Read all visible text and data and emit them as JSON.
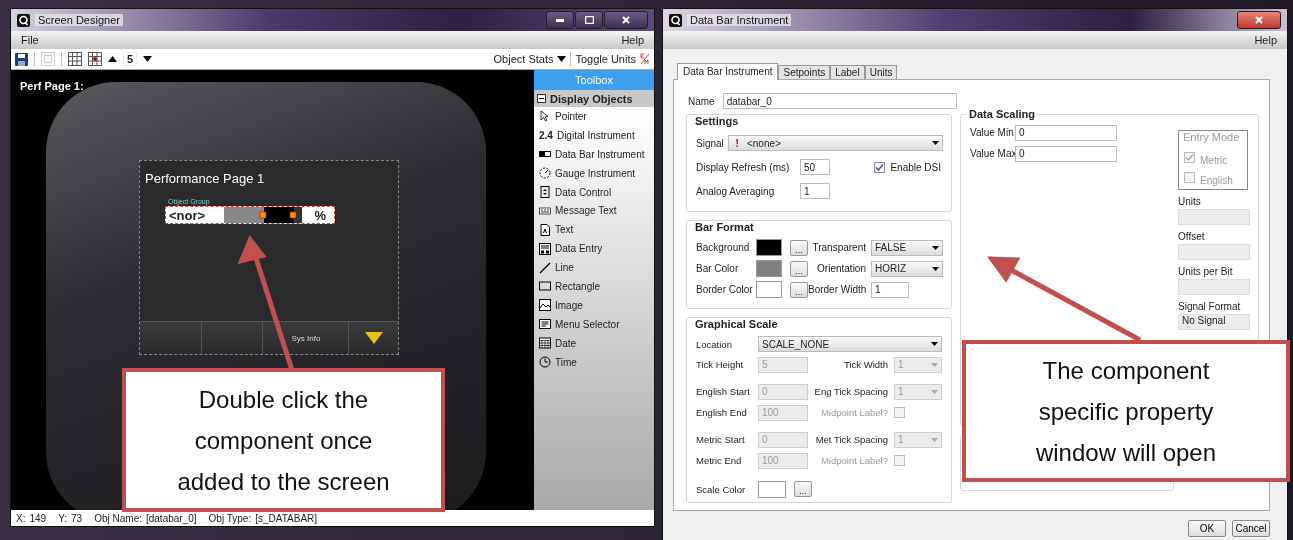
{
  "left_window": {
    "title": "Screen Designer",
    "menu": [
      "File",
      "Help"
    ],
    "toolbar": {
      "page_number": "5",
      "object_stats": "Object Stats",
      "toggle_units": "Toggle Units"
    },
    "canvas": {
      "page_label": "Perf Page 1:",
      "screen": {
        "title": "Performance Page 1",
        "group_label": "Object Group",
        "widget_value": "<nor>",
        "widget_unit": "%",
        "softkey_label": "Sys Info"
      }
    },
    "toolbox": {
      "title": "Toolbox",
      "section": {
        "label": "Display Objects",
        "expanded": true,
        "items": [
          {
            "label": "Pointer"
          },
          {
            "label": "Digital Instrument",
            "icon_text": "2.4"
          },
          {
            "label": "Data Bar Instrument"
          },
          {
            "label": "Gauge Instrument"
          },
          {
            "label": "Data Control"
          },
          {
            "label": "Message Text"
          },
          {
            "label": "Text"
          },
          {
            "label": "Data Entry"
          },
          {
            "label": "Line"
          },
          {
            "label": "Rectangle"
          },
          {
            "label": "Image"
          },
          {
            "label": "Menu Selector"
          },
          {
            "label": "Date"
          },
          {
            "label": "Time"
          }
        ]
      }
    },
    "status_bar": [
      {
        "label": "X:",
        "value": "149"
      },
      {
        "label": "Y:",
        "value": "73"
      },
      {
        "label": "Obj Name:",
        "value": "[databar_0]"
      },
      {
        "label": "Obj Type:",
        "value": "[s_DATABAR]"
      }
    ]
  },
  "right_window": {
    "title": "Data Bar Instrument",
    "menu": [
      "Help"
    ],
    "tabs": [
      {
        "label": "Data Bar Instrument",
        "selected": true
      },
      {
        "label": "Setpoints",
        "selected": false
      },
      {
        "label": "Label",
        "selected": false
      },
      {
        "label": "Units",
        "selected": false
      }
    ],
    "name": {
      "label": "Name",
      "value": "databar_0"
    },
    "settings": {
      "title": "Settings",
      "signal": {
        "label": "Signal",
        "flag": "!",
        "value": "<none>"
      },
      "refresh": {
        "label": "Display Refresh (ms)",
        "value": "50"
      },
      "enable_dsi": {
        "label": "Enable DSI",
        "checked": true
      },
      "averaging": {
        "label": "Analog Averaging",
        "value": "1"
      }
    },
    "bar_format": {
      "title": "Bar Format",
      "rows": [
        {
          "label": "Background",
          "color": "#000000",
          "button": "...",
          "field_label": "Transparent",
          "field_value": "FALSE",
          "kind": "dropdown"
        },
        {
          "label": "Bar Color",
          "color": "#808080",
          "button": "...",
          "field_label": "Orientation",
          "field_value": "HORIZ",
          "kind": "dropdown"
        },
        {
          "label": "Border Color",
          "color": "#ffffff",
          "button": "...",
          "field_label": "Border Width",
          "field_value": "1",
          "kind": "text"
        }
      ]
    },
    "graphical_scale": {
      "title": "Graphical Scale",
      "location": {
        "label": "Location",
        "value": "SCALE_NONE"
      },
      "rows": [
        {
          "label": "Tick Height",
          "value": "5",
          "disabled": true,
          "right": {
            "kind": "dropdown",
            "label": "Tick Width",
            "value": "1",
            "disabled": true
          }
        },
        {
          "label": "English Start",
          "value": "0",
          "disabled": true,
          "right": {
            "kind": "dropdown",
            "label": "Eng Tick Spacing",
            "value": "1",
            "disabled": true
          }
        },
        {
          "label": "English End",
          "value": "100",
          "disabled": true,
          "right": {
            "kind": "checkbox",
            "label": "Midpoint Label?",
            "checked": false,
            "disabled": true
          }
        },
        {
          "label": "Metric Start",
          "value": "0",
          "disabled": true,
          "right": {
            "kind": "dropdown",
            "label": "Met Tick Spacing",
            "value": "1",
            "disabled": true
          }
        },
        {
          "label": "Metric End",
          "value": "100",
          "disabled": true,
          "right": {
            "kind": "checkbox",
            "label": "Midpoint Label?",
            "checked": false,
            "disabled": true
          }
        }
      ],
      "scale_color": {
        "label": "Scale Color",
        "color": "#ffffff",
        "button": "..."
      }
    },
    "data_scaling": {
      "title": "Data Scaling",
      "fields": [
        {
          "label": "Value Min",
          "value": "0"
        },
        {
          "label": "Value Max",
          "value": "0"
        }
      ],
      "entry_mode": {
        "title": "Entry Mode",
        "disabled": true,
        "options": [
          {
            "label": "Metric",
            "checked": true
          },
          {
            "label": "English",
            "checked": false
          }
        ]
      },
      "side_fields": [
        {
          "label": "Units"
        },
        {
          "label": "Offset"
        },
        {
          "label": "Units per Bit"
        },
        {
          "label": "Signal Format",
          "value": "No Signal"
        }
      ]
    },
    "buttons": [
      "OK",
      "Cancel"
    ]
  },
  "callouts": [
    {
      "text": "Double click the component once added to the screen"
    },
    {
      "text": "The component specific property window will open"
    }
  ]
}
